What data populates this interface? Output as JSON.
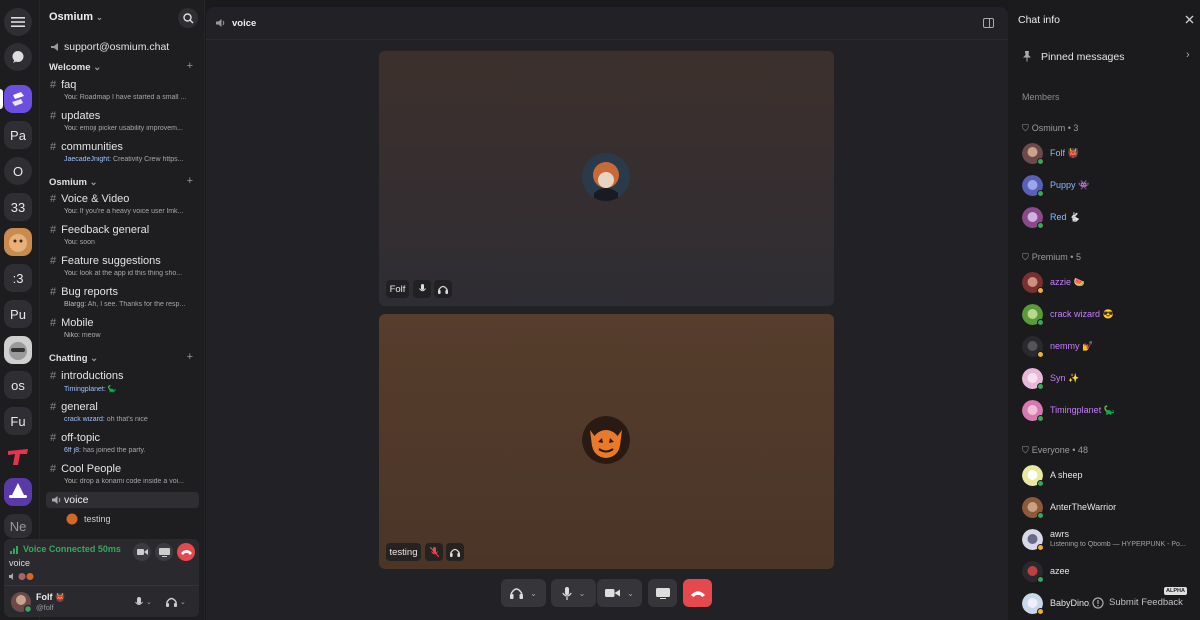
{
  "servers": [
    "Pa",
    "O",
    "33",
    ":3",
    "Pu",
    "os",
    "Fu",
    "Ne"
  ],
  "sidebar": {
    "server_name": "Osmium",
    "support": "support@osmium.chat",
    "categories": [
      {
        "name": "Welcome",
        "channels": [
          {
            "name": "faq",
            "who": "You:",
            "text": "Roadmap I have started a small ..."
          },
          {
            "name": "updates",
            "who": "You:",
            "text": "emoji picker usability improvem..."
          },
          {
            "name": "communities",
            "who": "JaecadeJnight:",
            "text": "Creativity Crew https..."
          }
        ]
      },
      {
        "name": "Osmium",
        "channels": [
          {
            "name": "Voice & Video",
            "who": "You:",
            "text": "If you're a heavy voice user lmk..."
          },
          {
            "name": "Feedback general",
            "who": "You:",
            "text": "soon"
          },
          {
            "name": "Feature suggestions",
            "who": "You:",
            "text": "look at the app id this thing sho..."
          },
          {
            "name": "Bug reports",
            "who": "Blargg:",
            "text": "Ah, I see. Thanks for the resp..."
          },
          {
            "name": "Mobile",
            "who": "Niko:",
            "text": "meow"
          }
        ]
      },
      {
        "name": "Chatting",
        "channels": [
          {
            "name": "introductions",
            "who": "Timingplanet:",
            "text": "🦕"
          },
          {
            "name": "general",
            "who": "crack wizard:",
            "text": "oh that's nice"
          },
          {
            "name": "off-topic",
            "who": "6ff j8:",
            "text": "has joined the party."
          },
          {
            "name": "Cool People",
            "who": "You:",
            "text": "drop a konami code inside a voi..."
          }
        ]
      }
    ],
    "voice_channel": "voice",
    "voice_member": "testing"
  },
  "voice_panel": {
    "status": "Voice Connected 50ms",
    "channel": "voice",
    "user": "Folf",
    "handle": "@folf"
  },
  "main": {
    "channel": "voice",
    "tiles": [
      {
        "name": "Folf"
      },
      {
        "name": "testing"
      }
    ]
  },
  "info": {
    "title": "Chat info",
    "pinned": "Pinned messages",
    "members_label": "Members",
    "groups": [
      {
        "name": "Osmium",
        "count": "3"
      },
      {
        "name": "Premium",
        "count": "5"
      },
      {
        "name": "Everyone",
        "count": "48"
      }
    ],
    "members": [
      {
        "name": "Folf",
        "emoji": "👹",
        "color": "#8fb6ff",
        "status": "online"
      },
      {
        "name": "Puppy",
        "emoji": "👾",
        "color": "#8fb6ff",
        "status": "online"
      },
      {
        "name": "Red",
        "emoji": "🐇",
        "color": "#8fb6ff",
        "status": "online"
      },
      {
        "name": "azzie",
        "emoji": "🍉",
        "color": "#c77dff",
        "status": "idle"
      },
      {
        "name": "crack wizard",
        "emoji": "😎",
        "color": "#c77dff",
        "status": "online"
      },
      {
        "name": "nemmy",
        "emoji": "💅",
        "color": "#c77dff",
        "status": "idle"
      },
      {
        "name": "Syn",
        "emoji": "✨",
        "color": "#c77dff",
        "status": "online"
      },
      {
        "name": "Timingplanet",
        "emoji": "🦕",
        "color": "#c77dff",
        "status": "online"
      },
      {
        "name": "A sheep",
        "emoji": "",
        "color": "#e6e6e6",
        "status": "online"
      },
      {
        "name": "AnterTheWarrior",
        "emoji": "",
        "color": "#e6e6e6",
        "status": "online"
      },
      {
        "name": "awrs",
        "emoji": "",
        "color": "#e6e6e6",
        "status": "idle",
        "sub": "Listening to Qbomb — HYPERPUNK - Po..."
      },
      {
        "name": "azee",
        "emoji": "",
        "color": "#e6e6e6",
        "status": "online"
      },
      {
        "name": "BabyDino14",
        "emoji": "",
        "color": "#e6e6e6",
        "status": "idle"
      }
    ],
    "feedback": "Submit Feedback",
    "alpha": "ALPHA"
  },
  "colors": {
    "accent": "#6c4ee0",
    "online": "#3ba55d",
    "idle": "#f0b132",
    "danger": "#e5484d",
    "voice_green": "#3ba55d"
  }
}
